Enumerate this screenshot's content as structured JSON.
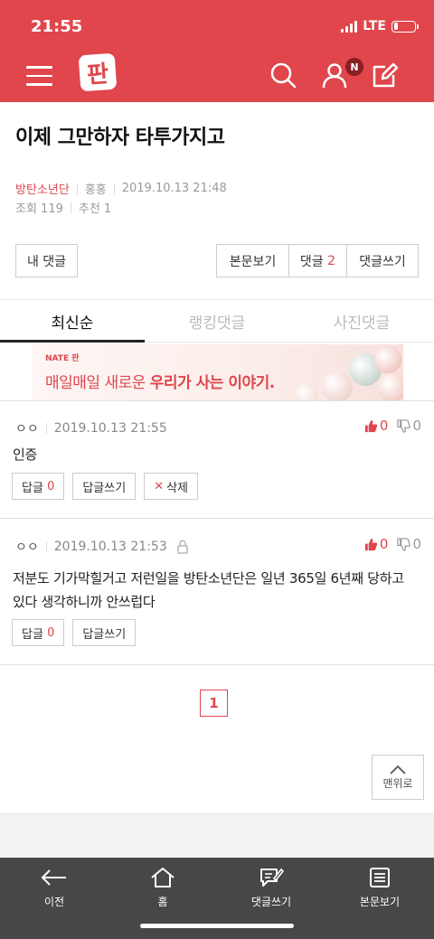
{
  "status": {
    "time": "21:55",
    "network": "LTE"
  },
  "header": {
    "logo": "판",
    "notif_badge": "N"
  },
  "article": {
    "title": "이제 그만하자 타투가지고",
    "author": "방탄소년단",
    "author2": "홍홍",
    "datetime": "2019.10.13 21:48",
    "views": "조회 119",
    "recommends": "추천 1"
  },
  "buttons": {
    "my_comments": "내 댓글",
    "view_post": "본문보기",
    "comments_label": "댓글",
    "comments_count": "2",
    "write_comment": "댓글쓰기"
  },
  "tabs": [
    {
      "label": "최신순"
    },
    {
      "label": "랭킹댓글"
    },
    {
      "label": "사진댓글"
    }
  ],
  "ad": {
    "brand": "NATE 판",
    "text_plain": "매일매일 새로운 ",
    "text_bold": "우리가 사는 이야기."
  },
  "comments": [
    {
      "nick": "ㅇㅇ",
      "datetime": "2019.10.13 21:55",
      "up": "0",
      "down": "0",
      "body": "인증",
      "reply_label": "답글",
      "reply_count": "0",
      "write_reply": "답글쓰기",
      "delete_label": "삭제"
    },
    {
      "nick": "ㅇㅇ",
      "datetime": "2019.10.13 21:53",
      "up": "0",
      "down": "0",
      "body": "저분도 기가막힐거고 저런일을 방탄소년단은 일년 365일 6년째 당하고 있다 생각하니까 안쓰럽다",
      "reply_label": "답글",
      "reply_count": "0",
      "write_reply": "답글쓰기"
    }
  ],
  "pagination": {
    "current": "1"
  },
  "to_top": "맨위로",
  "bottom_nav": [
    {
      "label": "이전",
      "icon": "back-arrow-icon"
    },
    {
      "label": "홈",
      "icon": "home-icon"
    },
    {
      "label": "댓글쓰기",
      "icon": "write-comment-icon"
    },
    {
      "label": "본문보기",
      "icon": "document-icon"
    }
  ],
  "colors": {
    "brand_red": "#e0464c",
    "bottom_bar": "#474747"
  }
}
